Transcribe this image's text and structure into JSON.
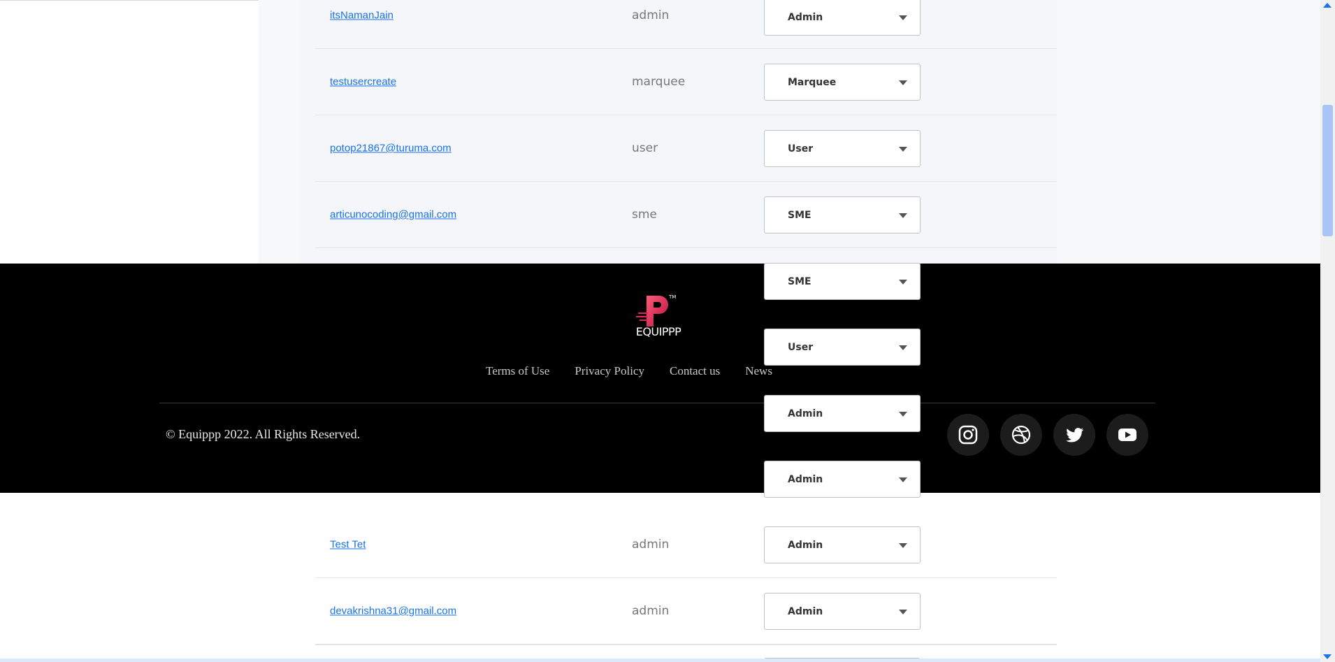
{
  "users_table": {
    "rows_top": [
      {
        "name": "itsNamanJain",
        "role": "admin",
        "selected": "Admin"
      },
      {
        "name": "testusercreate",
        "role": "marquee",
        "selected": "Marquee"
      },
      {
        "name": "potop21867@turuma.com",
        "role": "user",
        "selected": "User"
      },
      {
        "name": "articunocoding@gmail.com",
        "role": "sme",
        "selected": "SME"
      }
    ],
    "overlay_selects": [
      "SME",
      "User",
      "Admin",
      "Admin"
    ],
    "rows_bottom": [
      {
        "name": "Test Tet",
        "role": "admin",
        "selected": "Admin"
      },
      {
        "name": "devakrishna31@gmail.com",
        "role": "admin",
        "selected": "Admin"
      }
    ]
  },
  "footer": {
    "logo_text": "EQUIPPP",
    "links": [
      "Terms of Use",
      "Privacy Policy",
      "Contact us",
      "News"
    ],
    "copyright": "© Equippp 2022. All Rights Reserved.",
    "social_icons": [
      "instagram-icon",
      "dribbble-icon",
      "twitter-icon",
      "youtube-icon"
    ]
  },
  "colors": {
    "link": "#1a73e8",
    "footer_bg": "#000000",
    "logo_accent": "#e0245e"
  }
}
